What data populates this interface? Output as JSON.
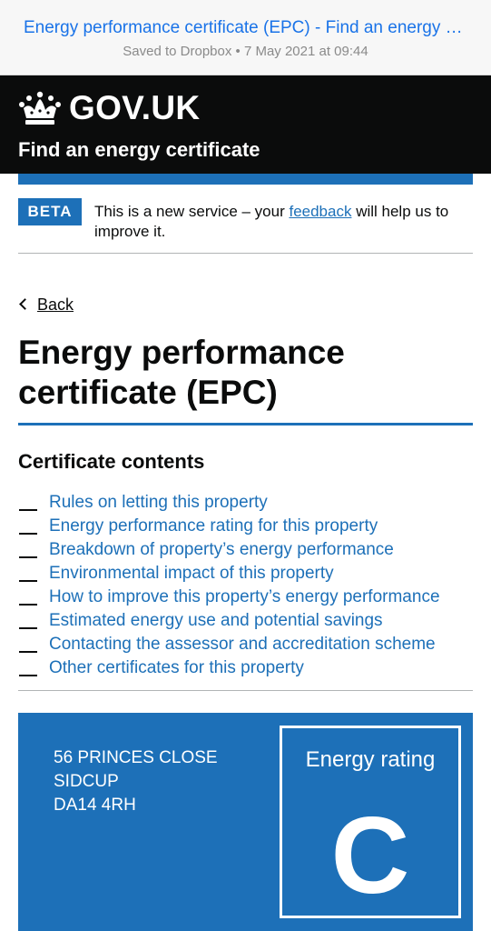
{
  "dropbox_bar": {
    "title": "Energy performance certificate (EPC) - Find an energy certificate",
    "subtitle": "Saved to Dropbox • 7 May 2021 at 09:44"
  },
  "header": {
    "logo_text": "GOV.UK",
    "service_name": "Find an energy certificate",
    "crown_icon": "crown-icon"
  },
  "phase_banner": {
    "tag": "BETA",
    "text_before": "This is a new service – your ",
    "link_text": "feedback",
    "text_after": " will help us to improve it."
  },
  "back_link": "Back",
  "page_title": "Energy performance certificate (EPC)",
  "contents": {
    "heading": "Certificate contents",
    "items": [
      "Rules on letting this property",
      "Energy performance rating for this property",
      "Breakdown of property’s energy performance",
      "Environmental impact of this property",
      "How to improve this property’s energy performance",
      "Estimated energy use and potential savings",
      "Contacting the assessor and accreditation scheme",
      "Other certificates for this property"
    ]
  },
  "epc_panel": {
    "address": [
      "56 PRINCES CLOSE",
      "SIDCUP",
      "DA14 4RH"
    ],
    "rating_label": "Energy rating",
    "rating_value": "C"
  },
  "colors": {
    "govuk_blue": "#1d70b8",
    "header_black": "#0b0c0c",
    "dropbox_link": "#1a73e8"
  }
}
